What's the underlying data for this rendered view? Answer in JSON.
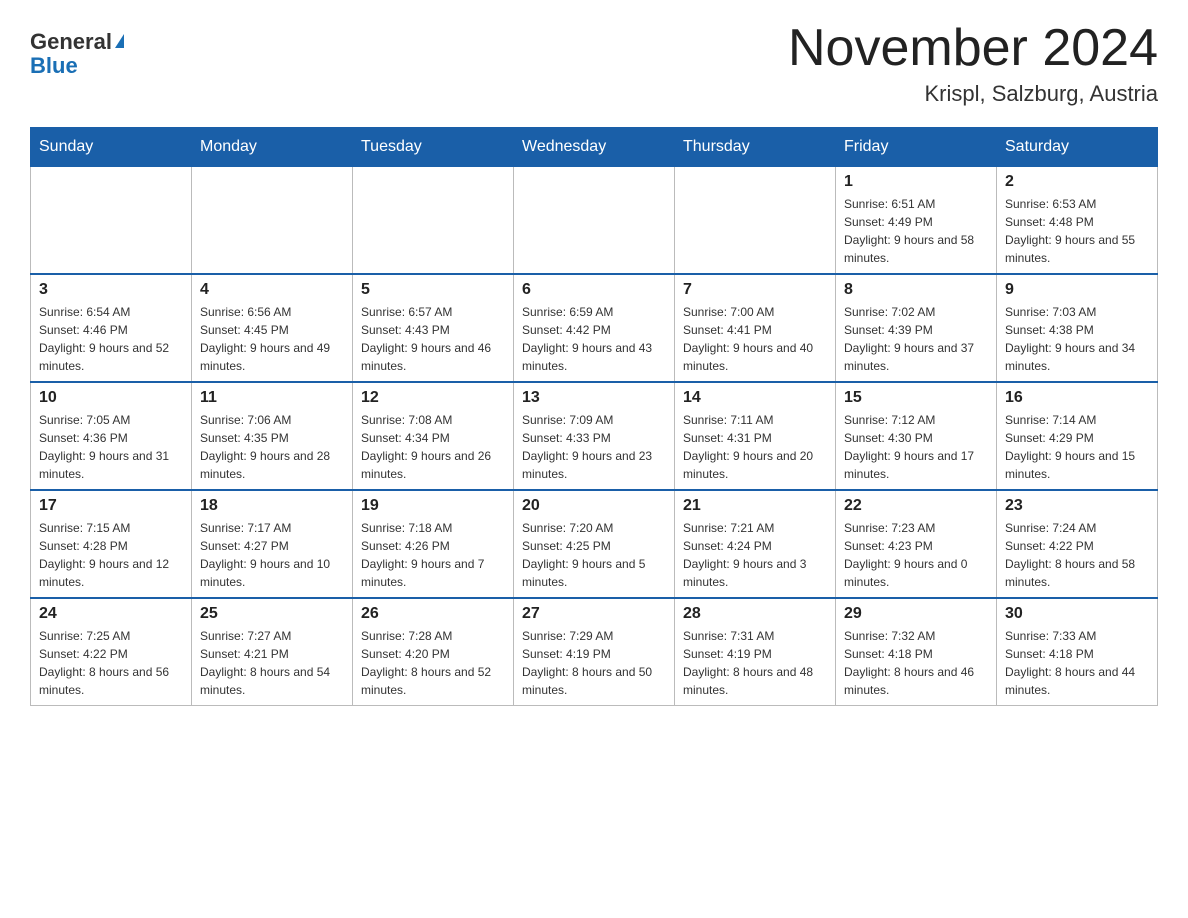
{
  "header": {
    "logo_line1": "General",
    "logo_line2": "Blue",
    "month_title": "November 2024",
    "location": "Krispl, Salzburg, Austria"
  },
  "weekdays": [
    "Sunday",
    "Monday",
    "Tuesday",
    "Wednesday",
    "Thursday",
    "Friday",
    "Saturday"
  ],
  "weeks": [
    [
      {
        "day": "",
        "sunrise": "",
        "sunset": "",
        "daylight": ""
      },
      {
        "day": "",
        "sunrise": "",
        "sunset": "",
        "daylight": ""
      },
      {
        "day": "",
        "sunrise": "",
        "sunset": "",
        "daylight": ""
      },
      {
        "day": "",
        "sunrise": "",
        "sunset": "",
        "daylight": ""
      },
      {
        "day": "",
        "sunrise": "",
        "sunset": "",
        "daylight": ""
      },
      {
        "day": "1",
        "sunrise": "Sunrise: 6:51 AM",
        "sunset": "Sunset: 4:49 PM",
        "daylight": "Daylight: 9 hours and 58 minutes."
      },
      {
        "day": "2",
        "sunrise": "Sunrise: 6:53 AM",
        "sunset": "Sunset: 4:48 PM",
        "daylight": "Daylight: 9 hours and 55 minutes."
      }
    ],
    [
      {
        "day": "3",
        "sunrise": "Sunrise: 6:54 AM",
        "sunset": "Sunset: 4:46 PM",
        "daylight": "Daylight: 9 hours and 52 minutes."
      },
      {
        "day": "4",
        "sunrise": "Sunrise: 6:56 AM",
        "sunset": "Sunset: 4:45 PM",
        "daylight": "Daylight: 9 hours and 49 minutes."
      },
      {
        "day": "5",
        "sunrise": "Sunrise: 6:57 AM",
        "sunset": "Sunset: 4:43 PM",
        "daylight": "Daylight: 9 hours and 46 minutes."
      },
      {
        "day": "6",
        "sunrise": "Sunrise: 6:59 AM",
        "sunset": "Sunset: 4:42 PM",
        "daylight": "Daylight: 9 hours and 43 minutes."
      },
      {
        "day": "7",
        "sunrise": "Sunrise: 7:00 AM",
        "sunset": "Sunset: 4:41 PM",
        "daylight": "Daylight: 9 hours and 40 minutes."
      },
      {
        "day": "8",
        "sunrise": "Sunrise: 7:02 AM",
        "sunset": "Sunset: 4:39 PM",
        "daylight": "Daylight: 9 hours and 37 minutes."
      },
      {
        "day": "9",
        "sunrise": "Sunrise: 7:03 AM",
        "sunset": "Sunset: 4:38 PM",
        "daylight": "Daylight: 9 hours and 34 minutes."
      }
    ],
    [
      {
        "day": "10",
        "sunrise": "Sunrise: 7:05 AM",
        "sunset": "Sunset: 4:36 PM",
        "daylight": "Daylight: 9 hours and 31 minutes."
      },
      {
        "day": "11",
        "sunrise": "Sunrise: 7:06 AM",
        "sunset": "Sunset: 4:35 PM",
        "daylight": "Daylight: 9 hours and 28 minutes."
      },
      {
        "day": "12",
        "sunrise": "Sunrise: 7:08 AM",
        "sunset": "Sunset: 4:34 PM",
        "daylight": "Daylight: 9 hours and 26 minutes."
      },
      {
        "day": "13",
        "sunrise": "Sunrise: 7:09 AM",
        "sunset": "Sunset: 4:33 PM",
        "daylight": "Daylight: 9 hours and 23 minutes."
      },
      {
        "day": "14",
        "sunrise": "Sunrise: 7:11 AM",
        "sunset": "Sunset: 4:31 PM",
        "daylight": "Daylight: 9 hours and 20 minutes."
      },
      {
        "day": "15",
        "sunrise": "Sunrise: 7:12 AM",
        "sunset": "Sunset: 4:30 PM",
        "daylight": "Daylight: 9 hours and 17 minutes."
      },
      {
        "day": "16",
        "sunrise": "Sunrise: 7:14 AM",
        "sunset": "Sunset: 4:29 PM",
        "daylight": "Daylight: 9 hours and 15 minutes."
      }
    ],
    [
      {
        "day": "17",
        "sunrise": "Sunrise: 7:15 AM",
        "sunset": "Sunset: 4:28 PM",
        "daylight": "Daylight: 9 hours and 12 minutes."
      },
      {
        "day": "18",
        "sunrise": "Sunrise: 7:17 AM",
        "sunset": "Sunset: 4:27 PM",
        "daylight": "Daylight: 9 hours and 10 minutes."
      },
      {
        "day": "19",
        "sunrise": "Sunrise: 7:18 AM",
        "sunset": "Sunset: 4:26 PM",
        "daylight": "Daylight: 9 hours and 7 minutes."
      },
      {
        "day": "20",
        "sunrise": "Sunrise: 7:20 AM",
        "sunset": "Sunset: 4:25 PM",
        "daylight": "Daylight: 9 hours and 5 minutes."
      },
      {
        "day": "21",
        "sunrise": "Sunrise: 7:21 AM",
        "sunset": "Sunset: 4:24 PM",
        "daylight": "Daylight: 9 hours and 3 minutes."
      },
      {
        "day": "22",
        "sunrise": "Sunrise: 7:23 AM",
        "sunset": "Sunset: 4:23 PM",
        "daylight": "Daylight: 9 hours and 0 minutes."
      },
      {
        "day": "23",
        "sunrise": "Sunrise: 7:24 AM",
        "sunset": "Sunset: 4:22 PM",
        "daylight": "Daylight: 8 hours and 58 minutes."
      }
    ],
    [
      {
        "day": "24",
        "sunrise": "Sunrise: 7:25 AM",
        "sunset": "Sunset: 4:22 PM",
        "daylight": "Daylight: 8 hours and 56 minutes."
      },
      {
        "day": "25",
        "sunrise": "Sunrise: 7:27 AM",
        "sunset": "Sunset: 4:21 PM",
        "daylight": "Daylight: 8 hours and 54 minutes."
      },
      {
        "day": "26",
        "sunrise": "Sunrise: 7:28 AM",
        "sunset": "Sunset: 4:20 PM",
        "daylight": "Daylight: 8 hours and 52 minutes."
      },
      {
        "day": "27",
        "sunrise": "Sunrise: 7:29 AM",
        "sunset": "Sunset: 4:19 PM",
        "daylight": "Daylight: 8 hours and 50 minutes."
      },
      {
        "day": "28",
        "sunrise": "Sunrise: 7:31 AM",
        "sunset": "Sunset: 4:19 PM",
        "daylight": "Daylight: 8 hours and 48 minutes."
      },
      {
        "day": "29",
        "sunrise": "Sunrise: 7:32 AM",
        "sunset": "Sunset: 4:18 PM",
        "daylight": "Daylight: 8 hours and 46 minutes."
      },
      {
        "day": "30",
        "sunrise": "Sunrise: 7:33 AM",
        "sunset": "Sunset: 4:18 PM",
        "daylight": "Daylight: 8 hours and 44 minutes."
      }
    ]
  ]
}
